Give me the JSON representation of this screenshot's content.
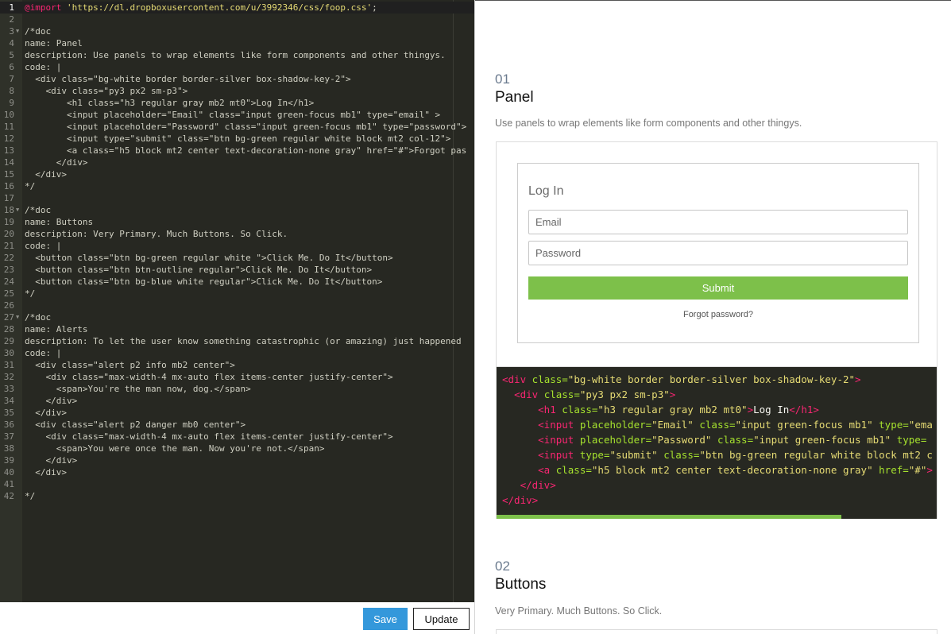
{
  "editor": {
    "active_line": 1,
    "lines": [
      {
        "n": "1",
        "fold": false,
        "parts": [
          [
            "kw",
            "@import"
          ],
          [
            "txt",
            " "
          ],
          [
            "str",
            "'https://dl.dropboxusercontent.com/u/3992346/css/foop.css'"
          ],
          [
            "txt",
            ";"
          ]
        ]
      },
      {
        "n": "2",
        "fold": false,
        "parts": []
      },
      {
        "n": "3",
        "fold": true,
        "parts": [
          [
            "txt",
            "/*doc"
          ]
        ]
      },
      {
        "n": "4",
        "fold": false,
        "parts": [
          [
            "txt",
            "name: Panel"
          ]
        ]
      },
      {
        "n": "5",
        "fold": false,
        "parts": [
          [
            "txt",
            "description: Use panels to wrap elements like form components and other thingys."
          ]
        ]
      },
      {
        "n": "6",
        "fold": false,
        "parts": [
          [
            "txt",
            "code: |"
          ]
        ]
      },
      {
        "n": "7",
        "fold": false,
        "parts": [
          [
            "txt",
            "  <div class=\"bg-white border border-silver box-shadow-key-2\">"
          ]
        ]
      },
      {
        "n": "8",
        "fold": false,
        "parts": [
          [
            "txt",
            "    <div class=\"py3 px2 sm-p3\">"
          ]
        ]
      },
      {
        "n": "9",
        "fold": false,
        "parts": [
          [
            "txt",
            "        <h1 class=\"h3 regular gray mb2 mt0\">Log In</h1>"
          ]
        ]
      },
      {
        "n": "10",
        "fold": false,
        "parts": [
          [
            "txt",
            "        <input placeholder=\"Email\" class=\"input green-focus mb1\" type=\"email\" >"
          ]
        ]
      },
      {
        "n": "11",
        "fold": false,
        "parts": [
          [
            "txt",
            "        <input placeholder=\"Password\" class=\"input green-focus mb1\" type=\"password\">"
          ]
        ]
      },
      {
        "n": "12",
        "fold": false,
        "parts": [
          [
            "txt",
            "        <input type=\"submit\" class=\"btn bg-green regular white block mt2 col-12\">"
          ]
        ]
      },
      {
        "n": "13",
        "fold": false,
        "parts": [
          [
            "txt",
            "        <a class=\"h5 block mt2 center text-decoration-none gray\" href=\"#\">Forgot pas"
          ]
        ]
      },
      {
        "n": "14",
        "fold": false,
        "parts": [
          [
            "txt",
            "      </div>"
          ]
        ]
      },
      {
        "n": "15",
        "fold": false,
        "parts": [
          [
            "txt",
            "  </div>"
          ]
        ]
      },
      {
        "n": "16",
        "fold": false,
        "parts": [
          [
            "txt",
            "*/"
          ]
        ]
      },
      {
        "n": "17",
        "fold": false,
        "parts": []
      },
      {
        "n": "18",
        "fold": true,
        "parts": [
          [
            "txt",
            "/*doc"
          ]
        ]
      },
      {
        "n": "19",
        "fold": false,
        "parts": [
          [
            "txt",
            "name: Buttons"
          ]
        ]
      },
      {
        "n": "20",
        "fold": false,
        "parts": [
          [
            "txt",
            "description: Very Primary. Much Buttons. So Click."
          ]
        ]
      },
      {
        "n": "21",
        "fold": false,
        "parts": [
          [
            "txt",
            "code: |"
          ]
        ]
      },
      {
        "n": "22",
        "fold": false,
        "parts": [
          [
            "txt",
            "  <button class=\"btn bg-green regular white \">Click Me. Do It</button>"
          ]
        ]
      },
      {
        "n": "23",
        "fold": false,
        "parts": [
          [
            "txt",
            "  <button class=\"btn btn-outline regular\">Click Me. Do It</button>"
          ]
        ]
      },
      {
        "n": "24",
        "fold": false,
        "parts": [
          [
            "txt",
            "  <button class=\"btn bg-blue white regular\">Click Me. Do It</button>"
          ]
        ]
      },
      {
        "n": "25",
        "fold": false,
        "parts": [
          [
            "txt",
            "*/"
          ]
        ]
      },
      {
        "n": "26",
        "fold": false,
        "parts": []
      },
      {
        "n": "27",
        "fold": true,
        "parts": [
          [
            "txt",
            "/*doc"
          ]
        ]
      },
      {
        "n": "28",
        "fold": false,
        "parts": [
          [
            "txt",
            "name: Alerts"
          ]
        ]
      },
      {
        "n": "29",
        "fold": false,
        "parts": [
          [
            "txt",
            "description: To let the user know something catastrophic (or amazing) just happened"
          ]
        ]
      },
      {
        "n": "30",
        "fold": false,
        "parts": [
          [
            "txt",
            "code: |"
          ]
        ]
      },
      {
        "n": "31",
        "fold": false,
        "parts": [
          [
            "txt",
            "  <div class=\"alert p2 info mb2 center\">"
          ]
        ]
      },
      {
        "n": "32",
        "fold": false,
        "parts": [
          [
            "txt",
            "    <div class=\"max-width-4 mx-auto flex items-center justify-center\">"
          ]
        ]
      },
      {
        "n": "33",
        "fold": false,
        "parts": [
          [
            "txt",
            "      <span>You're the man now, dog.</span>"
          ]
        ]
      },
      {
        "n": "34",
        "fold": false,
        "parts": [
          [
            "txt",
            "    </div>"
          ]
        ]
      },
      {
        "n": "35",
        "fold": false,
        "parts": [
          [
            "txt",
            "  </div>"
          ]
        ]
      },
      {
        "n": "36",
        "fold": false,
        "parts": [
          [
            "txt",
            "  <div class=\"alert p2 danger mb0 center\">"
          ]
        ]
      },
      {
        "n": "37",
        "fold": false,
        "parts": [
          [
            "txt",
            "    <div class=\"max-width-4 mx-auto flex items-center justify-center\">"
          ]
        ]
      },
      {
        "n": "38",
        "fold": false,
        "parts": [
          [
            "txt",
            "      <span>You were once the man. Now you're not.</span>"
          ]
        ]
      },
      {
        "n": "39",
        "fold": false,
        "parts": [
          [
            "txt",
            "    </div>"
          ]
        ]
      },
      {
        "n": "40",
        "fold": false,
        "parts": [
          [
            "txt",
            "  </div>"
          ]
        ]
      },
      {
        "n": "41",
        "fold": false,
        "parts": []
      },
      {
        "n": "42",
        "fold": false,
        "parts": [
          [
            "txt",
            "*/"
          ]
        ]
      }
    ]
  },
  "footer": {
    "save_label": "Save",
    "update_label": "Update"
  },
  "preview": {
    "sections": [
      {
        "number": "01",
        "title": "Panel",
        "description": "Use panels to wrap elements like form components and other thingys."
      },
      {
        "number": "02",
        "title": "Buttons",
        "description": "Very Primary. Much Buttons. So Click."
      }
    ],
    "panel_demo": {
      "login_title": "Log In",
      "email_placeholder": "Email",
      "password_placeholder": "Password",
      "submit_label": "Submit",
      "forgot_label": "Forgot password?"
    },
    "code_block": {
      "lines": [
        [
          [
            "tg",
            "<div "
          ],
          [
            "at",
            "class="
          ],
          [
            "sv",
            "\"bg-white border border-silver box-shadow-key-2\""
          ],
          [
            "tg",
            ">"
          ]
        ],
        [
          [
            "tx",
            "  "
          ],
          [
            "tg",
            "<div "
          ],
          [
            "at",
            "class="
          ],
          [
            "sv",
            "\"py3 px2 sm-p3\""
          ],
          [
            "tg",
            ">"
          ]
        ],
        [
          [
            "tx",
            "      "
          ],
          [
            "tg",
            "<h1 "
          ],
          [
            "at",
            "class="
          ],
          [
            "sv",
            "\"h3 regular gray mb2 mt0\""
          ],
          [
            "tg",
            ">"
          ],
          [
            "tx",
            "Log In"
          ],
          [
            "tg",
            "</h1>"
          ]
        ],
        [
          [
            "tx",
            "      "
          ],
          [
            "tg",
            "<input "
          ],
          [
            "at",
            "placeholder="
          ],
          [
            "sv",
            "\"Email\""
          ],
          [
            "tx",
            " "
          ],
          [
            "at",
            "class="
          ],
          [
            "sv",
            "\"input green-focus mb1\""
          ],
          [
            "tx",
            " "
          ],
          [
            "at",
            "type="
          ],
          [
            "sv",
            "\"ema"
          ]
        ],
        [
          [
            "tx",
            "      "
          ],
          [
            "tg",
            "<input "
          ],
          [
            "at",
            "placeholder="
          ],
          [
            "sv",
            "\"Password\""
          ],
          [
            "tx",
            " "
          ],
          [
            "at",
            "class="
          ],
          [
            "sv",
            "\"input green-focus mb1\""
          ],
          [
            "tx",
            " "
          ],
          [
            "at",
            "type="
          ]
        ],
        [
          [
            "tx",
            "      "
          ],
          [
            "tg",
            "<input "
          ],
          [
            "at",
            "type="
          ],
          [
            "sv",
            "\"submit\""
          ],
          [
            "tx",
            " "
          ],
          [
            "at",
            "class="
          ],
          [
            "sv",
            "\"btn bg-green regular white block mt2 c"
          ]
        ],
        [
          [
            "tx",
            "      "
          ],
          [
            "tg",
            "<a "
          ],
          [
            "at",
            "class="
          ],
          [
            "sv",
            "\"h5 block mt2 center text-decoration-none gray\""
          ],
          [
            "tx",
            " "
          ],
          [
            "at",
            "href="
          ],
          [
            "sv",
            "\"#\""
          ],
          [
            "tg",
            ">"
          ]
        ],
        [
          [
            "tx",
            "   "
          ],
          [
            "tg",
            "</div>"
          ]
        ],
        [
          [
            "tg",
            "</div>"
          ]
        ]
      ],
      "scroll_fraction": 0.78
    }
  },
  "colors": {
    "editor_bg": "#272822",
    "accent_green": "#7dc04a",
    "save_blue": "#3498db"
  }
}
